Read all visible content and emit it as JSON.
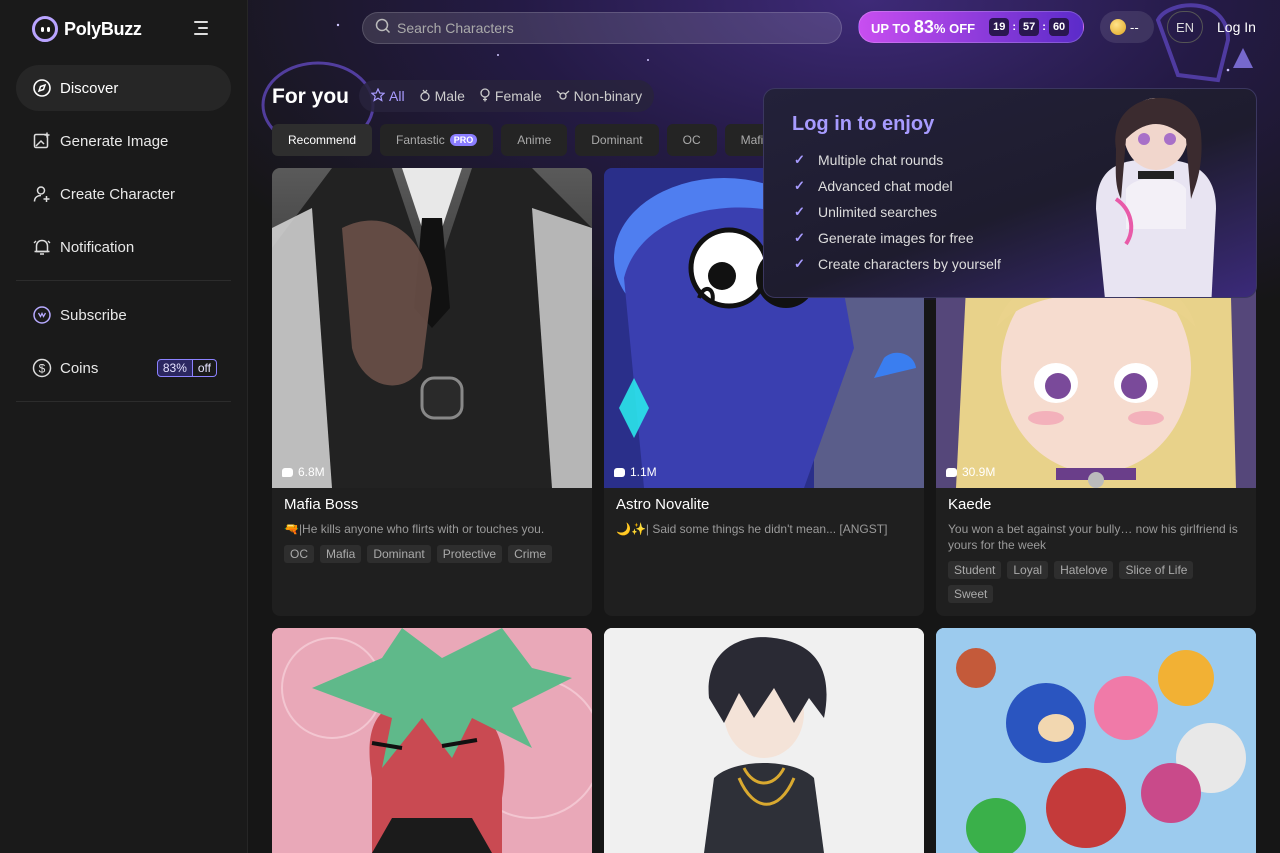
{
  "app": {
    "name": "PolyBuzz"
  },
  "sidebar": {
    "items": [
      {
        "label": "Discover",
        "icon": "compass-icon",
        "active": true
      },
      {
        "label": "Generate Image",
        "icon": "image-plus-icon",
        "active": false
      },
      {
        "label": "Create Character",
        "icon": "user-plus-icon",
        "active": false
      },
      {
        "label": "Notification",
        "icon": "bell-icon",
        "active": false
      }
    ],
    "secondary": [
      {
        "label": "Subscribe",
        "icon": "crown-icon"
      },
      {
        "label": "Coins",
        "icon": "dollar-icon",
        "badge_percent": "83%",
        "badge_off": "off"
      }
    ]
  },
  "header": {
    "search_placeholder": "Search Characters",
    "promo": {
      "prefix": "UP TO",
      "percent": "83",
      "suffix": "% OFF",
      "timer": [
        "19",
        "57",
        "60"
      ]
    },
    "coins": "--",
    "language": "EN",
    "login": "Log In"
  },
  "feed": {
    "title": "For you",
    "gender_tabs": [
      {
        "label": "All",
        "icon": "star-icon",
        "active": true
      },
      {
        "label": "Male",
        "icon": "male-icon",
        "active": false
      },
      {
        "label": "Female",
        "icon": "female-icon",
        "active": false
      },
      {
        "label": "Non-binary",
        "icon": "nonbinary-icon",
        "active": false
      }
    ],
    "categories": [
      {
        "label": "Recommend",
        "active": true
      },
      {
        "label": "Fantastic",
        "pro": "PRO"
      },
      {
        "label": "Anime"
      },
      {
        "label": "Dominant"
      },
      {
        "label": "OC"
      },
      {
        "label": "Mafia"
      }
    ],
    "cards": [
      {
        "name": "Mafia Boss",
        "count": "6.8M",
        "desc": "🔫|He kills anyone who flirts with or touches you.",
        "tags": [
          "OC",
          "Mafia",
          "Dominant",
          "Protective",
          "Crime"
        ]
      },
      {
        "name": "Astro Novalite",
        "count": "1.1M",
        "desc": "🌙✨| Said some things he didn't mean... [ANGST]",
        "tags": []
      },
      {
        "name": "Kaede",
        "count": "30.9M",
        "desc": "You won a bet against your bully… now his girlfriend is yours for the week",
        "tags": [
          "Student",
          "Loyal",
          "Hatelove",
          "Slice of Life",
          "Sweet"
        ]
      }
    ]
  },
  "login_popup": {
    "title": "Log in to enjoy",
    "benefits": [
      "Multiple chat rounds",
      "Advanced chat model",
      "Unlimited searches",
      "Generate images for free",
      "Create characters by yourself"
    ]
  }
}
